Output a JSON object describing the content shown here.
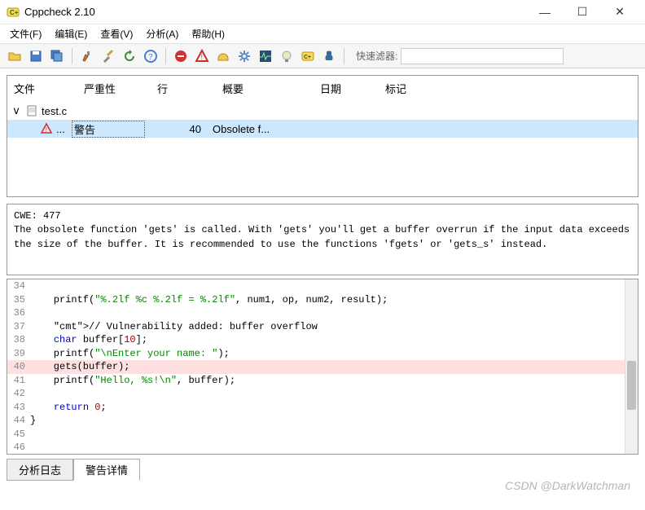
{
  "title": "Cppcheck 2.10",
  "window_buttons": {
    "minimize": "—",
    "maximize": "☐",
    "close": "✕"
  },
  "menu": [
    "文件(F)",
    "编辑(E)",
    "查看(V)",
    "分析(A)",
    "帮助(H)"
  ],
  "toolbar_icons": [
    "open-folder-icon",
    "save-icon",
    "save-all-icon",
    "brush-icon",
    "tools-icon",
    "refresh-icon",
    "help-icon",
    "stop-icon",
    "warning-icon",
    "helmet-icon",
    "gear-icon",
    "ecg-icon",
    "bulb-icon",
    "cppcheck-icon",
    "addon-icon"
  ],
  "quickfilter": {
    "label": "快速滤器:",
    "value": ""
  },
  "tree": {
    "headers": {
      "file": "文件",
      "severity": "严重性",
      "line": "行",
      "summary": "概要",
      "date": "日期",
      "tag": "标记"
    },
    "file": {
      "expanded": "v",
      "name": "test.c"
    },
    "issue": {
      "dots": "...",
      "severity": "警告",
      "line": "40",
      "summary": "Obsolete f..."
    }
  },
  "detail": {
    "cwe": "CWE: 477",
    "msg": "The obsolete function 'gets' is called. With 'gets' you'll get a buffer overrun if the input data exceeds the size of the buffer. It is recommended to use the functions 'fgets' or 'gets_s' instead."
  },
  "code": {
    "lines": [
      {
        "n": "34",
        "raw": ""
      },
      {
        "n": "35",
        "raw": "    printf(\"%.2lf %c %.2lf = %.2lf\", num1, op, num2, result);"
      },
      {
        "n": "36",
        "raw": ""
      },
      {
        "n": "37",
        "raw": "    // Vulnerability added: buffer overflow"
      },
      {
        "n": "38",
        "raw": "    char buffer[10];"
      },
      {
        "n": "39",
        "raw": "    printf(\"\\nEnter your name: \");"
      },
      {
        "n": "40",
        "raw": "    gets(buffer);",
        "hl": true
      },
      {
        "n": "41",
        "raw": "    printf(\"Hello, %s!\\n\", buffer);"
      },
      {
        "n": "42",
        "raw": ""
      },
      {
        "n": "43",
        "raw": "    return 0;"
      },
      {
        "n": "44",
        "raw": "}"
      },
      {
        "n": "45",
        "raw": ""
      },
      {
        "n": "46",
        "raw": ""
      }
    ]
  },
  "tabs": {
    "log": "分析日志",
    "detail": "警告详情"
  },
  "watermark": "CSDN @DarkWatchman"
}
